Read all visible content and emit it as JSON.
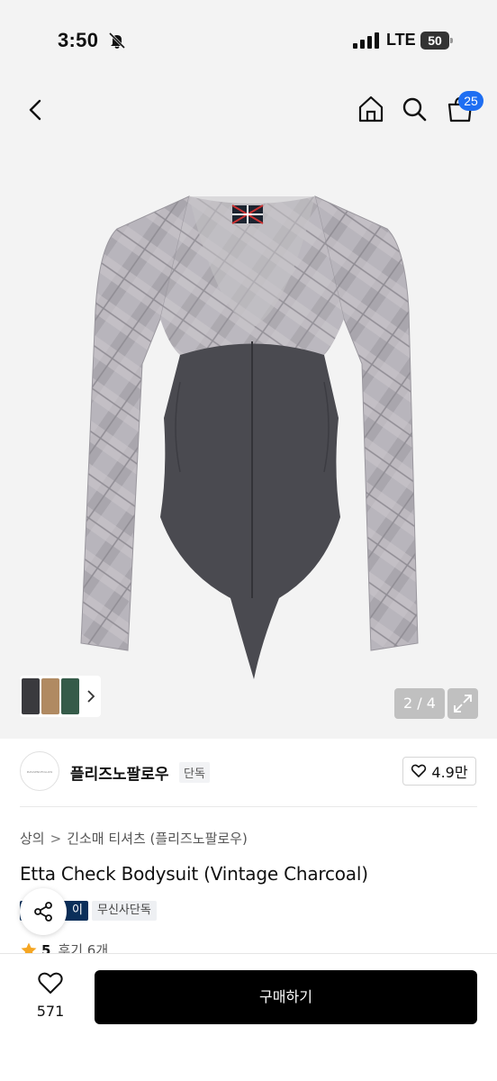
{
  "status_bar": {
    "time": "3:50",
    "network": "LTE",
    "battery": "50"
  },
  "nav": {
    "cart_count": "25"
  },
  "gallery": {
    "counter": "2 / 4"
  },
  "brand": {
    "name": "플리즈노팔로우",
    "exclusive_tag": "단독",
    "like_count": "4.9만"
  },
  "product": {
    "breadcrumb": [
      "상의",
      "긴소매 티셔츠 (플리즈노팔로우)"
    ],
    "title": "Etta Check Bodysuit (Vintage Charcoal)",
    "tag_dark": "이",
    "tag_light": "무신사단독",
    "rating": "5",
    "review_count": "후기 6개"
  },
  "bottom_bar": {
    "wishlist_count": "571",
    "buy_label": "구매하기"
  },
  "colors": {
    "cart_badge": "#1e6ef2",
    "buy_button": "#000000",
    "gallery_bg": "#f3f3f3",
    "star": "#f5a623",
    "tag_dark": "#0b2f5a"
  },
  "icons": [
    "bell-off-icon",
    "signal-icon",
    "back-icon",
    "home-icon",
    "search-icon",
    "cart-icon",
    "expand-icon",
    "heart-icon",
    "share-icon",
    "star-icon",
    "chevron-right-icon"
  ]
}
